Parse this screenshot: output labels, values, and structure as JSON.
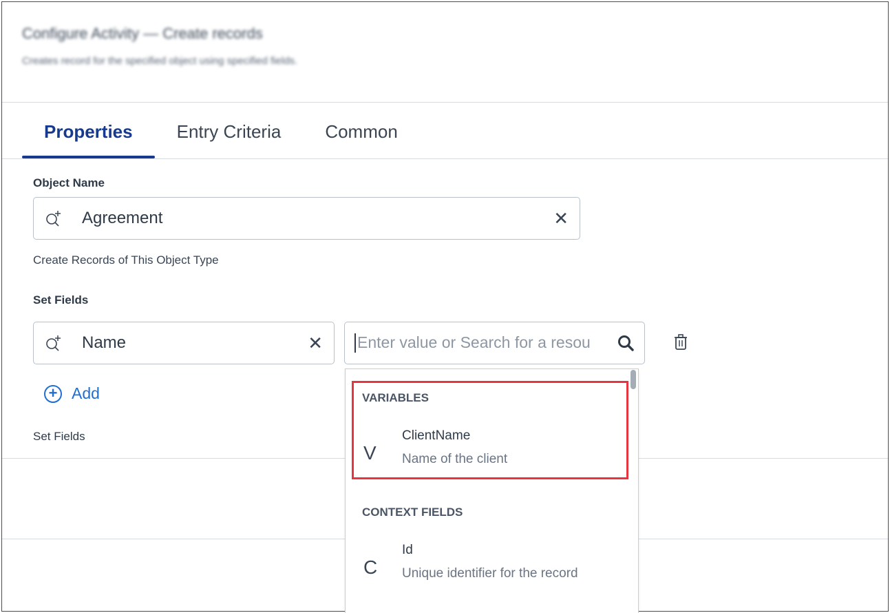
{
  "header": {
    "title": "Configure Activity — Create records",
    "subtitle": "Creates record for the specified object using specified fields."
  },
  "tabs": [
    {
      "label": "Properties",
      "active": true
    },
    {
      "label": "Entry Criteria",
      "active": false
    },
    {
      "label": "Common",
      "active": false
    }
  ],
  "object_name": {
    "label": "Object Name",
    "value": "Agreement",
    "clear_symbol": "✕",
    "help_text": "Create Records of This Object Type"
  },
  "set_fields": {
    "label": "Set Fields",
    "field_value": "Name",
    "clear_symbol": "✕",
    "value_placeholder": "Enter value or Search for a resou",
    "add_label": "Add",
    "footer_label": "Set Fields"
  },
  "dropdown": {
    "sections": [
      {
        "heading": "VARIABLES",
        "items": [
          {
            "badge": "V",
            "name": "ClientName",
            "description": "Name of the client"
          }
        ]
      },
      {
        "heading": "CONTEXT FIELDS",
        "items": [
          {
            "badge": "C",
            "name": "Id",
            "description": "Unique identifier for the record"
          }
        ]
      }
    ]
  },
  "colors": {
    "accent": "#173a8f",
    "link": "#1f6fd1",
    "highlight": "#e8343c",
    "border": "#b9c0c8"
  },
  "icons": {
    "lookup": "lookup-search-plus-icon",
    "clear": "close-icon",
    "search": "search-icon",
    "delete": "trash-icon",
    "add": "plus-circle-icon"
  }
}
